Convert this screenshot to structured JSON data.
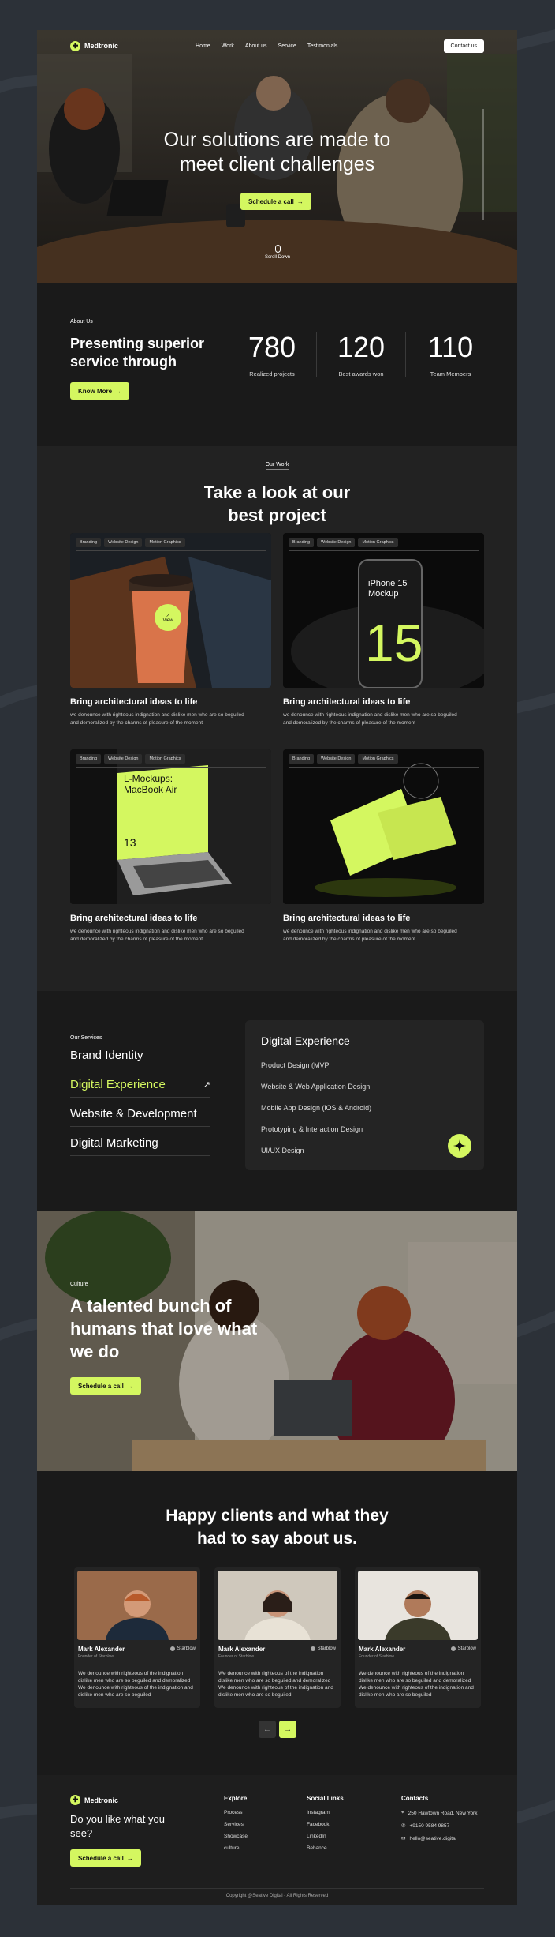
{
  "brand": {
    "name": "Medtronic",
    "accent": "#d4f760"
  },
  "nav": {
    "links": [
      "Home",
      "Work",
      "About us",
      "Service",
      "Testimonials"
    ],
    "contact": "Contact us"
  },
  "hero": {
    "title_line1": "Our solutions are made to",
    "title_line2": "meet client challenges",
    "cta": "Schedule a call",
    "scroll": "Scroll Down"
  },
  "about": {
    "label": "About Us",
    "title": "Presenting superior service through",
    "button": "Know More",
    "stats": [
      {
        "value": "780",
        "label": "Realized projects"
      },
      {
        "value": "120",
        "label": "Best awards won"
      },
      {
        "value": "110",
        "label": "Team Members"
      }
    ]
  },
  "work": {
    "label": "Our Work",
    "title_line1": "Take a look at our",
    "title_line2": "best project",
    "tags": [
      "Branding",
      "Website Design",
      "Motion Graphics"
    ],
    "view": "View",
    "projects": [
      {
        "title": "Bring architectural ideas to life",
        "desc_line1": "we denounce with righteous indignation and dislike men who are so beguiled",
        "desc_line2": "and demoralized by the charms of pleasure of the moment"
      },
      {
        "title": "Bring architectural ideas to life",
        "desc_line1": "we denounce with righteous indignation and dislike men who are so beguiled",
        "desc_line2": "and demoralized by the charms of pleasure of the moment"
      },
      {
        "title": "Bring architectural ideas to life",
        "desc_line1": "we denounce with righteous indignation and dislike men who are so beguiled",
        "desc_line2": "and demoralized by the charms of pleasure of the moment"
      },
      {
        "title": "Bring architectural ideas to life",
        "desc_line1": "we denounce with righteous indignation and dislike men who are so beguiled",
        "desc_line2": "and demoralized by the charms of pleasure of the moment"
      }
    ],
    "mockup_iphone": "iPhone 15 Mockup",
    "mockup_iphone_num": "15",
    "mockup_laptop": "L-Mockups: MacBook Air",
    "mockup_laptop_num": "13"
  },
  "services": {
    "label": "Our Services",
    "items": [
      "Brand Identity",
      "Digital Experience",
      "Website & Development",
      "Digital Marketing"
    ],
    "active_index": 1,
    "panel_title": "Digital Experience",
    "panel_items": [
      "Product Design (MVP",
      "Website & Web Application Design",
      "Mobile App Design (iOS & Android)",
      "Prototyping & Interaction Design",
      "UI/UX Design"
    ]
  },
  "culture": {
    "label": "Culture",
    "title": "A talented bunch of humans that love what we do",
    "cta": "Schedule a call"
  },
  "testimonials": {
    "title_line1": "Happy clients and what they",
    "title_line2": "had to say about us.",
    "items": [
      {
        "name": "Mark Alexander",
        "role": "Founder of Starblow",
        "company": "Starblow",
        "quote": "We denounce with righteous of the indignation dislike men who are so beguiled and demoralized We denounce with righteous of the indignation and dislike men who are so beguiled"
      },
      {
        "name": "Mark Alexander",
        "role": "Founder of Starblow",
        "company": "Starblow",
        "quote": "We denounce with righteous of the indignation dislike men who are so beguiled and demoralized We denounce with righteous of the indignation and dislike men who are so beguiled"
      },
      {
        "name": "Mark Alexander",
        "role": "Founder of Starblow",
        "company": "Starblow",
        "quote": "We denounce with righteous of the indignation dislike men who are so beguiled and demoralized We denounce with righteous of the indignation and dislike men who are so beguiled"
      }
    ]
  },
  "footer": {
    "tagline": "Do you like what you see?",
    "cta": "Schedule a call",
    "explore_title": "Explore",
    "explore": [
      "Process",
      "Services",
      "Showcase",
      "culture"
    ],
    "social_title": "Social Links",
    "social": [
      "Instagram",
      "Facebook",
      "LinkedIn",
      "Behance"
    ],
    "contacts_title": "Contacts",
    "address": "250 Hawtown Road, New York",
    "phone": "+9150 9584 9857",
    "email": "hello@seative.digital",
    "copyright": "Copyright @Seative Digital - All Rights Reserved"
  }
}
